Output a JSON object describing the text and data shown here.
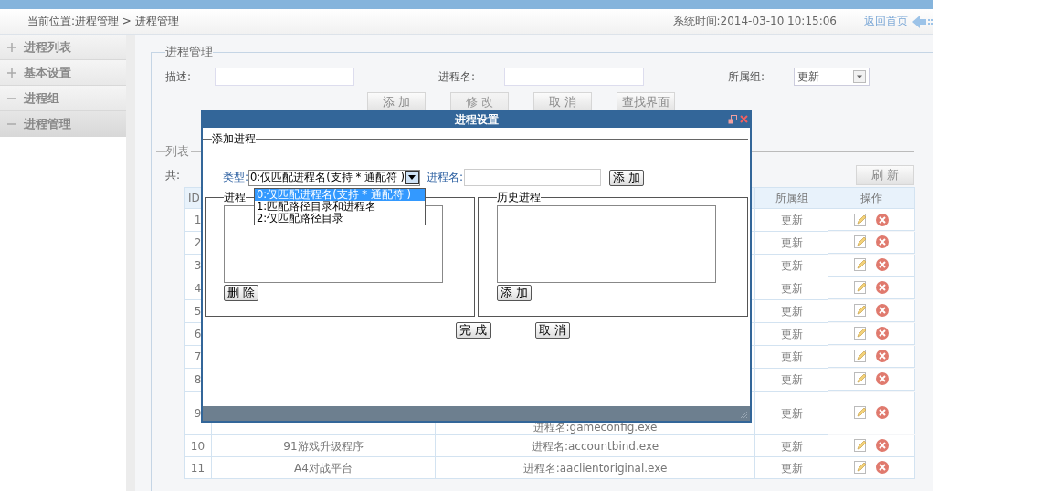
{
  "header": {
    "breadcrumb": "当前位置:进程管理 > 进程管理",
    "system_time": "系统时间:2014-03-10 10:15:06",
    "home_link": "返回首页"
  },
  "sidebar": {
    "items": [
      {
        "label": "进程列表",
        "expanded": false,
        "selected": false
      },
      {
        "label": "基本设置",
        "expanded": false,
        "selected": false
      },
      {
        "label": "进程组",
        "expanded": true,
        "selected": false
      },
      {
        "label": "进程管理",
        "expanded": true,
        "selected": true
      }
    ]
  },
  "form": {
    "legend": "进程管理",
    "description_label": "描述:",
    "process_name_label": "进程名:",
    "group_label": "所属组:",
    "group_value": "更新",
    "buttons": [
      {
        "label": "添 加",
        "disabled": false
      },
      {
        "label": "修 改",
        "disabled": true
      },
      {
        "label": "取 消",
        "disabled": false
      },
      {
        "label": "查找界面",
        "disabled": false
      }
    ]
  },
  "list": {
    "legend": "列表",
    "count_label": "共:",
    "refresh_button": "刷 新"
  },
  "table": {
    "header": {
      "id": "ID",
      "group": "所属组",
      "actions": "操作"
    },
    "rows": [
      {
        "id": "1",
        "group": "更新"
      },
      {
        "id": "2",
        "group": "更新"
      },
      {
        "id": "3",
        "group": "更新"
      },
      {
        "id": "4",
        "group": "更新"
      },
      {
        "id": "5",
        "group": "更新"
      },
      {
        "id": "6",
        "group": "更新"
      },
      {
        "id": "7",
        "group": "更新"
      },
      {
        "id": "8",
        "group": "更新"
      },
      {
        "id": "9",
        "column_3": "进程名:gameconfig.exe",
        "group": "更新"
      },
      {
        "id": "10",
        "column_2": "91游戏升级程序",
        "column_3": "进程名:accountbind.exe",
        "group": "更新"
      },
      {
        "id": "11",
        "column_2": "A4对战平台",
        "column_3": "进程名:aaclientoriginal.exe",
        "group": "更新"
      }
    ]
  },
  "dialog": {
    "title": "进程设置",
    "legend": "添加进程",
    "type_label": "类型:",
    "type_value": "0:仅匹配进程名(支持 * 通配符 )",
    "type_options": [
      {
        "label": "0:仅匹配进程名(支持 * 通配符 )",
        "selected": true
      },
      {
        "label": "1:匹配路径目录和进程名",
        "selected": false
      },
      {
        "label": "2:仅匹配路径目录",
        "selected": false
      }
    ],
    "name_label": "进程名:",
    "add_button": "添 加",
    "process_panel": {
      "legend": "进程",
      "button": "删 除"
    },
    "history_panel": {
      "legend": "历史进程",
      "button": "添 加"
    },
    "done_button": "完 成",
    "cancel_button": "取 消"
  }
}
